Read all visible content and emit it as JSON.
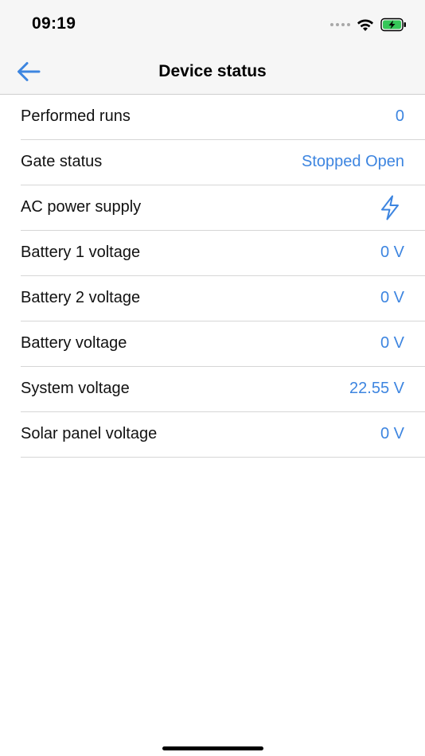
{
  "status_bar": {
    "time": "09:19",
    "icons": [
      "signal-dots-icon",
      "wifi-icon",
      "battery-charging-icon"
    ]
  },
  "nav": {
    "back_icon": "arrow-left-icon",
    "title": "Device status"
  },
  "rows": [
    {
      "label": "Performed runs",
      "value": "0"
    },
    {
      "label": "Gate status",
      "value": "Stopped Open"
    },
    {
      "label": "AC power supply",
      "icon": "lightning-bolt-icon"
    },
    {
      "label": "Battery 1 voltage",
      "value": "0 V"
    },
    {
      "label": "Battery 2 voltage",
      "value": "0 V"
    },
    {
      "label": "Battery voltage",
      "value": "0 V"
    },
    {
      "label": "System voltage",
      "value": "22.55 V"
    },
    {
      "label": "Solar panel voltage",
      "value": "0 V"
    }
  ],
  "colors": {
    "accent": "#3d85e0",
    "battery_fill": "#35c759",
    "bar_background": "#f6f6f6"
  }
}
